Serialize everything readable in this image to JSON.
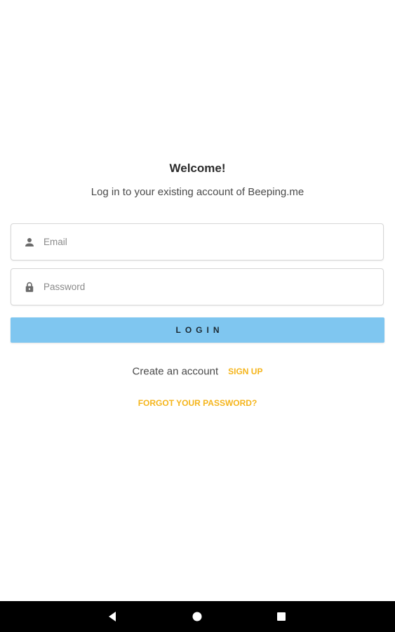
{
  "header": {
    "title": "Welcome!",
    "subtitle": "Log in to your existing account of Beeping.me"
  },
  "form": {
    "email_placeholder": "Email",
    "email_icon": "person-icon",
    "password_placeholder": "Password",
    "password_icon": "lock-icon",
    "login_label": "LOGIN"
  },
  "signup": {
    "prompt": "Create an account",
    "link_label": "SIGN UP"
  },
  "forgot": {
    "label": "FORGOT YOUR PASSWORD?"
  },
  "navbar": {
    "buttons": [
      "back-icon",
      "home-icon",
      "recents-icon"
    ]
  },
  "colors": {
    "accent": "#f5b51c",
    "login_button": "#7fc6f0",
    "navbar": "#000000"
  }
}
